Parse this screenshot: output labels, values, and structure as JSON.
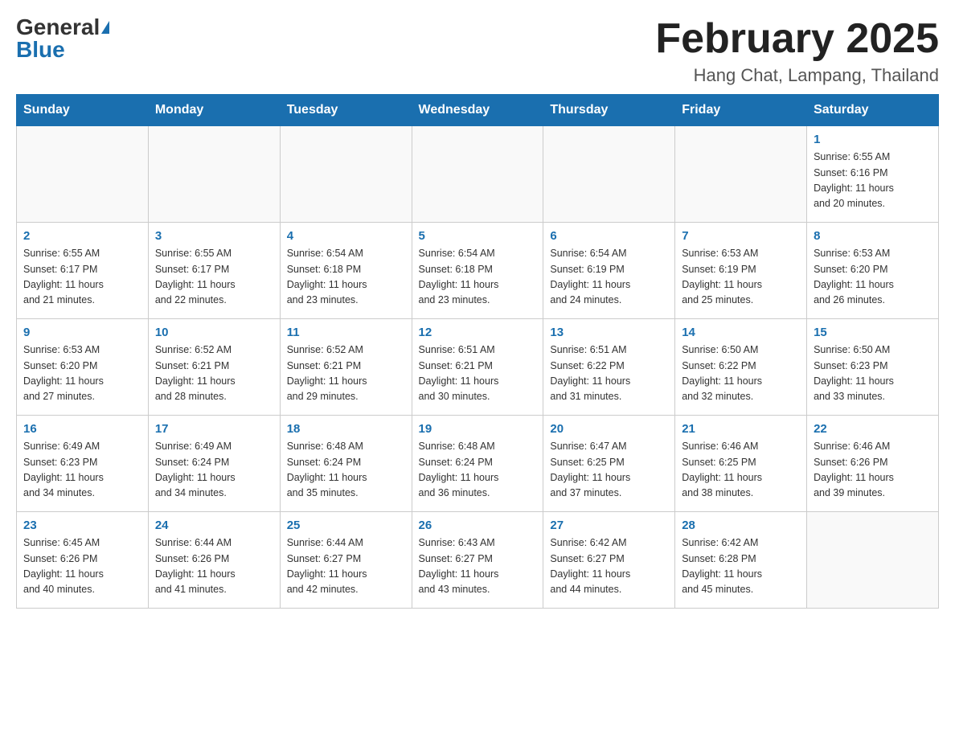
{
  "header": {
    "logo_general": "General",
    "logo_blue": "Blue",
    "month_title": "February 2025",
    "location": "Hang Chat, Lampang, Thailand"
  },
  "weekdays": [
    "Sunday",
    "Monday",
    "Tuesday",
    "Wednesday",
    "Thursday",
    "Friday",
    "Saturday"
  ],
  "weeks": [
    [
      {
        "day": "",
        "info": ""
      },
      {
        "day": "",
        "info": ""
      },
      {
        "day": "",
        "info": ""
      },
      {
        "day": "",
        "info": ""
      },
      {
        "day": "",
        "info": ""
      },
      {
        "day": "",
        "info": ""
      },
      {
        "day": "1",
        "info": "Sunrise: 6:55 AM\nSunset: 6:16 PM\nDaylight: 11 hours\nand 20 minutes."
      }
    ],
    [
      {
        "day": "2",
        "info": "Sunrise: 6:55 AM\nSunset: 6:17 PM\nDaylight: 11 hours\nand 21 minutes."
      },
      {
        "day": "3",
        "info": "Sunrise: 6:55 AM\nSunset: 6:17 PM\nDaylight: 11 hours\nand 22 minutes."
      },
      {
        "day": "4",
        "info": "Sunrise: 6:54 AM\nSunset: 6:18 PM\nDaylight: 11 hours\nand 23 minutes."
      },
      {
        "day": "5",
        "info": "Sunrise: 6:54 AM\nSunset: 6:18 PM\nDaylight: 11 hours\nand 23 minutes."
      },
      {
        "day": "6",
        "info": "Sunrise: 6:54 AM\nSunset: 6:19 PM\nDaylight: 11 hours\nand 24 minutes."
      },
      {
        "day": "7",
        "info": "Sunrise: 6:53 AM\nSunset: 6:19 PM\nDaylight: 11 hours\nand 25 minutes."
      },
      {
        "day": "8",
        "info": "Sunrise: 6:53 AM\nSunset: 6:20 PM\nDaylight: 11 hours\nand 26 minutes."
      }
    ],
    [
      {
        "day": "9",
        "info": "Sunrise: 6:53 AM\nSunset: 6:20 PM\nDaylight: 11 hours\nand 27 minutes."
      },
      {
        "day": "10",
        "info": "Sunrise: 6:52 AM\nSunset: 6:21 PM\nDaylight: 11 hours\nand 28 minutes."
      },
      {
        "day": "11",
        "info": "Sunrise: 6:52 AM\nSunset: 6:21 PM\nDaylight: 11 hours\nand 29 minutes."
      },
      {
        "day": "12",
        "info": "Sunrise: 6:51 AM\nSunset: 6:21 PM\nDaylight: 11 hours\nand 30 minutes."
      },
      {
        "day": "13",
        "info": "Sunrise: 6:51 AM\nSunset: 6:22 PM\nDaylight: 11 hours\nand 31 minutes."
      },
      {
        "day": "14",
        "info": "Sunrise: 6:50 AM\nSunset: 6:22 PM\nDaylight: 11 hours\nand 32 minutes."
      },
      {
        "day": "15",
        "info": "Sunrise: 6:50 AM\nSunset: 6:23 PM\nDaylight: 11 hours\nand 33 minutes."
      }
    ],
    [
      {
        "day": "16",
        "info": "Sunrise: 6:49 AM\nSunset: 6:23 PM\nDaylight: 11 hours\nand 34 minutes."
      },
      {
        "day": "17",
        "info": "Sunrise: 6:49 AM\nSunset: 6:24 PM\nDaylight: 11 hours\nand 34 minutes."
      },
      {
        "day": "18",
        "info": "Sunrise: 6:48 AM\nSunset: 6:24 PM\nDaylight: 11 hours\nand 35 minutes."
      },
      {
        "day": "19",
        "info": "Sunrise: 6:48 AM\nSunset: 6:24 PM\nDaylight: 11 hours\nand 36 minutes."
      },
      {
        "day": "20",
        "info": "Sunrise: 6:47 AM\nSunset: 6:25 PM\nDaylight: 11 hours\nand 37 minutes."
      },
      {
        "day": "21",
        "info": "Sunrise: 6:46 AM\nSunset: 6:25 PM\nDaylight: 11 hours\nand 38 minutes."
      },
      {
        "day": "22",
        "info": "Sunrise: 6:46 AM\nSunset: 6:26 PM\nDaylight: 11 hours\nand 39 minutes."
      }
    ],
    [
      {
        "day": "23",
        "info": "Sunrise: 6:45 AM\nSunset: 6:26 PM\nDaylight: 11 hours\nand 40 minutes."
      },
      {
        "day": "24",
        "info": "Sunrise: 6:44 AM\nSunset: 6:26 PM\nDaylight: 11 hours\nand 41 minutes."
      },
      {
        "day": "25",
        "info": "Sunrise: 6:44 AM\nSunset: 6:27 PM\nDaylight: 11 hours\nand 42 minutes."
      },
      {
        "day": "26",
        "info": "Sunrise: 6:43 AM\nSunset: 6:27 PM\nDaylight: 11 hours\nand 43 minutes."
      },
      {
        "day": "27",
        "info": "Sunrise: 6:42 AM\nSunset: 6:27 PM\nDaylight: 11 hours\nand 44 minutes."
      },
      {
        "day": "28",
        "info": "Sunrise: 6:42 AM\nSunset: 6:28 PM\nDaylight: 11 hours\nand 45 minutes."
      },
      {
        "day": "",
        "info": ""
      }
    ]
  ]
}
